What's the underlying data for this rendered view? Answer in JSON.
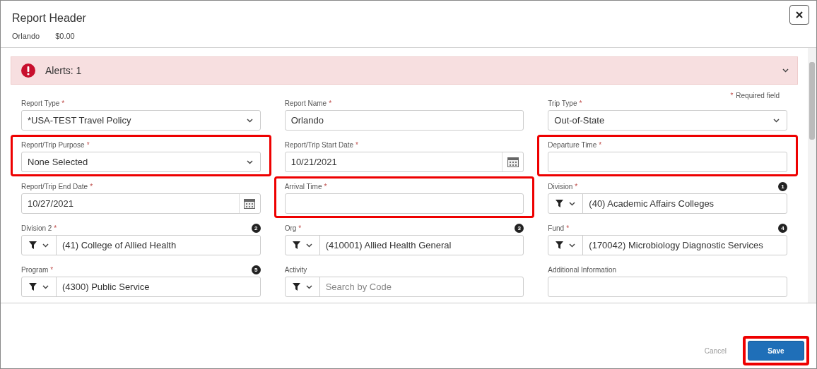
{
  "dialog": {
    "title": "Report Header",
    "subtitle": [
      "Orlando",
      "$0.00"
    ]
  },
  "alerts": {
    "label": "Alerts: 1",
    "expanded": false
  },
  "required_note": {
    "mark": "*",
    "text": "Required field"
  },
  "fields": [
    {
      "label": "Report Type",
      "mark": "*",
      "kind": "select",
      "value": "*USA-TEST Travel Policy",
      "highlighted": false
    },
    {
      "label": "Report Name",
      "mark": "*",
      "kind": "text",
      "value": "Orlando",
      "highlighted": false
    },
    {
      "label": "Trip Type",
      "mark": "*",
      "kind": "select",
      "value": "Out-of-State",
      "highlighted": false
    },
    {
      "label": "Report/Trip Purpose",
      "mark": "*",
      "kind": "select",
      "value": "None Selected",
      "highlighted": true
    },
    {
      "label": "Report/Trip Start Date",
      "mark": "*",
      "kind": "date",
      "value": "10/21/2021",
      "highlighted": false
    },
    {
      "label": "Departure Time",
      "mark": "*",
      "kind": "text",
      "highlighted": true
    },
    {
      "label": "Report/Trip End Date",
      "mark": "*",
      "kind": "date",
      "value": "10/27/2021",
      "highlighted": false
    },
    {
      "label": "Arrival Time",
      "mark": "*",
      "kind": "text",
      "highlighted": true
    },
    {
      "label": "Division",
      "mark": "*",
      "kind": "lookup",
      "value": "(40) Academic Affairs Colleges",
      "badge": "1",
      "highlighted": false
    },
    {
      "label": "Division 2",
      "mark": "*",
      "kind": "lookup",
      "value": "(41) College of Allied Health",
      "badge": "2",
      "highlighted": false
    },
    {
      "label": "Org",
      "mark": "*",
      "kind": "lookup",
      "value": "(410001) Allied Health General",
      "badge": "3",
      "highlighted": false
    },
    {
      "label": "Fund",
      "mark": "*",
      "kind": "lookup",
      "value": "(170042) Microbiology Diagnostic Services",
      "badge": "4",
      "highlighted": false
    },
    {
      "label": "Program",
      "mark": "*",
      "kind": "lookup",
      "value": "(4300) Public Service",
      "badge": "5",
      "highlighted": false
    },
    {
      "label": "Activity",
      "kind": "lookup",
      "placeholder": "Search by Code",
      "highlighted": false
    },
    {
      "label": "Additional Information",
      "kind": "text",
      "highlighted": false
    }
  ],
  "buttons": [
    {
      "label": "Cancel",
      "kind": "link",
      "highlighted": false
    },
    {
      "label": "Save",
      "kind": "primary",
      "highlighted": true
    }
  ]
}
